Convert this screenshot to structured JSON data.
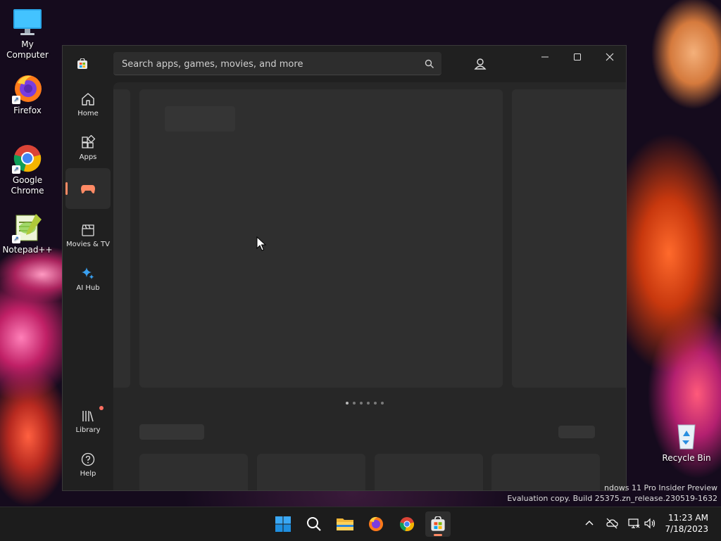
{
  "desktop": {
    "icons": [
      {
        "label": "My Computer"
      },
      {
        "label": "Firefox"
      },
      {
        "label": "Google Chrome"
      },
      {
        "label": "Notepad++"
      },
      {
        "label": "Recycle Bin"
      }
    ],
    "watermark": {
      "line1": "ndows 11 Pro Insider Preview",
      "line2": "Evaluation copy. Build 25375.zn_release.230519-1632"
    }
  },
  "store": {
    "search": {
      "placeholder": "Search apps, games, movies, and more"
    },
    "nav": [
      {
        "label": "Home",
        "icon": "home-icon"
      },
      {
        "label": "Apps",
        "icon": "apps-icon"
      },
      {
        "label": "",
        "icon": "gamepad-icon",
        "active": true
      },
      {
        "label": "Movies & TV",
        "icon": "clapperboard-icon"
      },
      {
        "label": "AI Hub",
        "icon": "sparkle-icon"
      }
    ],
    "nav_bottom": [
      {
        "label": "Library",
        "icon": "library-icon",
        "badge": true
      },
      {
        "label": "Help",
        "icon": "help-icon"
      }
    ],
    "carousel": {
      "page_count": 6,
      "active_page": 1
    },
    "colors": {
      "accent": "#ff8a65",
      "background": "#202020",
      "content": "#272727"
    }
  },
  "taskbar": {
    "apps": [
      "start",
      "search",
      "file-explorer",
      "firefox",
      "chrome",
      "microsoft-store"
    ],
    "active_app": "microsoft-store",
    "clock": {
      "time": "11:23 AM",
      "date": "7/18/2023"
    }
  }
}
